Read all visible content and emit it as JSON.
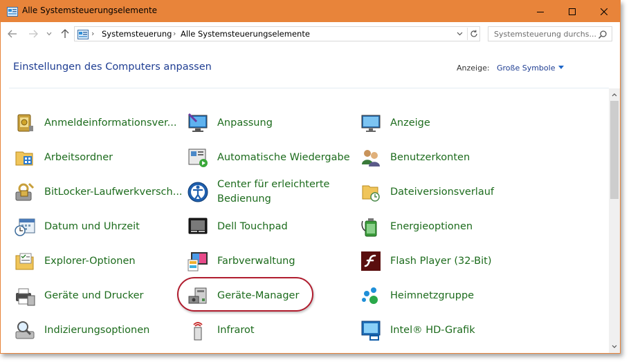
{
  "window": {
    "title": "Alle Systemsteuerungselemente",
    "frame_color": "#e8843a"
  },
  "breadcrumb": [
    "Systemsteuerung",
    "Alle Systemsteuerungselemente"
  ],
  "search": {
    "placeholder": "Systemsteuerung durchs..."
  },
  "header": {
    "title": "Einstellungen des Computers anpassen",
    "view_label": "Anzeige:",
    "view_value": "Große Symbole"
  },
  "items": [
    {
      "label": "Anmeldeinformationsver...",
      "icon": "credential-manager-icon"
    },
    {
      "label": "Anpassung",
      "icon": "personalization-icon"
    },
    {
      "label": "Anzeige",
      "icon": "display-icon"
    },
    {
      "label": "Arbeitsordner",
      "icon": "work-folders-icon"
    },
    {
      "label": "Automatische Wiedergabe",
      "icon": "autoplay-icon"
    },
    {
      "label": "Benutzerkonten",
      "icon": "user-accounts-icon"
    },
    {
      "label": "BitLocker-Laufwerkversch...",
      "icon": "bitlocker-icon"
    },
    {
      "label": "Center für erleichterte Bedienung",
      "label_line1": "Center für erleichterte",
      "label_line2": "Bedienung",
      "icon": "ease-of-access-icon"
    },
    {
      "label": "Dateiversionsverlauf",
      "icon": "file-history-icon"
    },
    {
      "label": "Datum und Uhrzeit",
      "icon": "date-time-icon"
    },
    {
      "label": "Dell Touchpad",
      "icon": "touchpad-icon"
    },
    {
      "label": "Energieoptionen",
      "icon": "power-options-icon"
    },
    {
      "label": "Explorer-Optionen",
      "icon": "explorer-options-icon"
    },
    {
      "label": "Farbverwaltung",
      "icon": "color-management-icon"
    },
    {
      "label": "Flash Player (32-Bit)",
      "icon": "flash-player-icon"
    },
    {
      "label": "Geräte und Drucker",
      "icon": "devices-printers-icon"
    },
    {
      "label": "Geräte-Manager",
      "icon": "device-manager-icon"
    },
    {
      "label": "Heimnetzgruppe",
      "icon": "homegroup-icon"
    },
    {
      "label": "Indizierungsoptionen",
      "icon": "indexing-options-icon"
    },
    {
      "label": "Infrarot",
      "icon": "infrared-icon"
    },
    {
      "label": "Intel® HD-Grafik",
      "icon": "intel-graphics-icon"
    }
  ],
  "colors": {
    "link": "#1c6b1c",
    "title": "#1e3d92",
    "highlight": "#b01c2e"
  }
}
